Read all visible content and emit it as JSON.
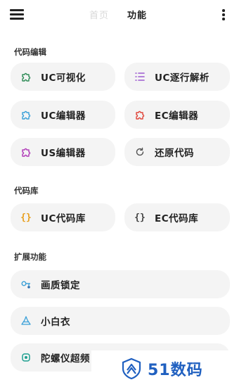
{
  "header": {
    "tabs": [
      {
        "label": "首页",
        "active": false
      },
      {
        "label": "功能",
        "active": true
      }
    ]
  },
  "sections": {
    "code_edit": {
      "title": "代码编辑",
      "items": [
        {
          "label": "UC可视化",
          "icon": "puzzle-icon",
          "color": "#2e8b57"
        },
        {
          "label": "UC逐行解析",
          "icon": "list-icon",
          "color": "#9b59d0"
        },
        {
          "label": "UC编辑器",
          "icon": "puzzle-icon",
          "color": "#3aa0d8"
        },
        {
          "label": "EC编辑器",
          "icon": "puzzle-icon",
          "color": "#e0453a"
        },
        {
          "label": "US编辑器",
          "icon": "puzzle-icon",
          "color": "#b03ab8"
        },
        {
          "label": "还原代码",
          "icon": "refresh-icon",
          "color": "#555555"
        }
      ]
    },
    "code_lib": {
      "title": "代码库",
      "items": [
        {
          "label": "UC代码库",
          "icon": "braces-icon",
          "color": "#e8a020"
        },
        {
          "label": "EC代码库",
          "icon": "braces-icon",
          "color": "#444444"
        }
      ]
    },
    "extensions": {
      "title": "扩展功能",
      "items": [
        {
          "label": "画质锁定",
          "icon": "key-icon",
          "color": "#3aa0d8"
        },
        {
          "label": "小白衣",
          "icon": "person-icon",
          "color": "#3aa0d8"
        },
        {
          "label": "陀螺仪超频",
          "icon": "gyroscope-icon",
          "color": "#1fa090"
        }
      ]
    }
  },
  "watermark": {
    "text": "51数码",
    "color": "#2060c0"
  }
}
